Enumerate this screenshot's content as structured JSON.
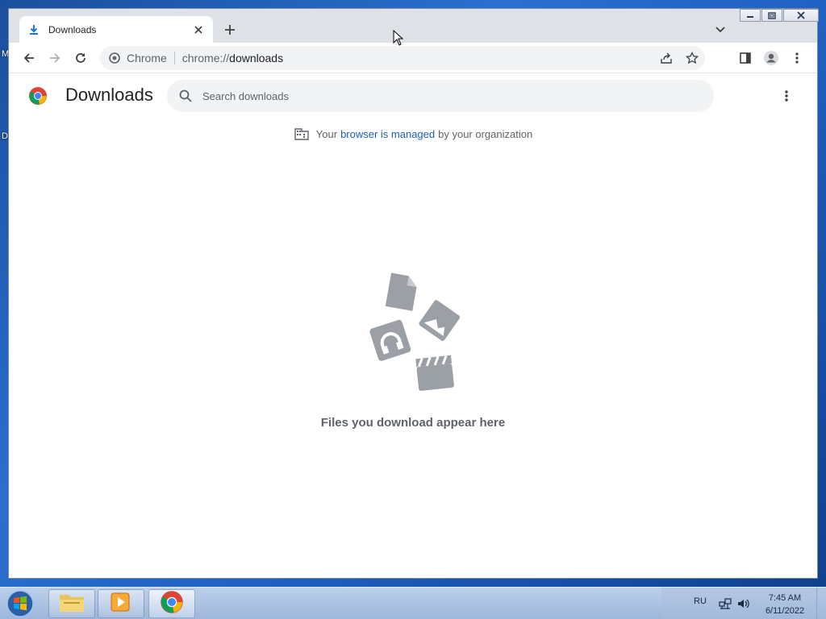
{
  "desktop": {
    "fragment_1": "M",
    "fragment_2": "D"
  },
  "browser": {
    "tab": {
      "title": "Downloads",
      "icon": "download-icon",
      "close_icon": "close-icon"
    },
    "toolbar": {
      "chip_label": "Chrome",
      "url_scheme": "chrome://",
      "url_path": "downloads"
    }
  },
  "page": {
    "title": "Downloads",
    "search": {
      "placeholder": "Search downloads"
    },
    "managed": {
      "prefix": "Your",
      "link": "browser is managed",
      "suffix": "by your organization"
    },
    "empty_message": "Files you download appear here"
  },
  "taskbar": {
    "items": [
      {
        "name": "file-explorer",
        "icon": "folder-icon"
      },
      {
        "name": "media-player",
        "icon": "media-player-icon"
      },
      {
        "name": "chrome",
        "icon": "chrome-icon",
        "active": true
      }
    ],
    "language": "RU",
    "time": "7:45 AM",
    "date": "6/11/2022"
  },
  "colors": {
    "accent": "#1a73e8",
    "link": "#1a5fb4",
    "muted_text": "#5f6368",
    "illustration": "#9aa0a6"
  }
}
